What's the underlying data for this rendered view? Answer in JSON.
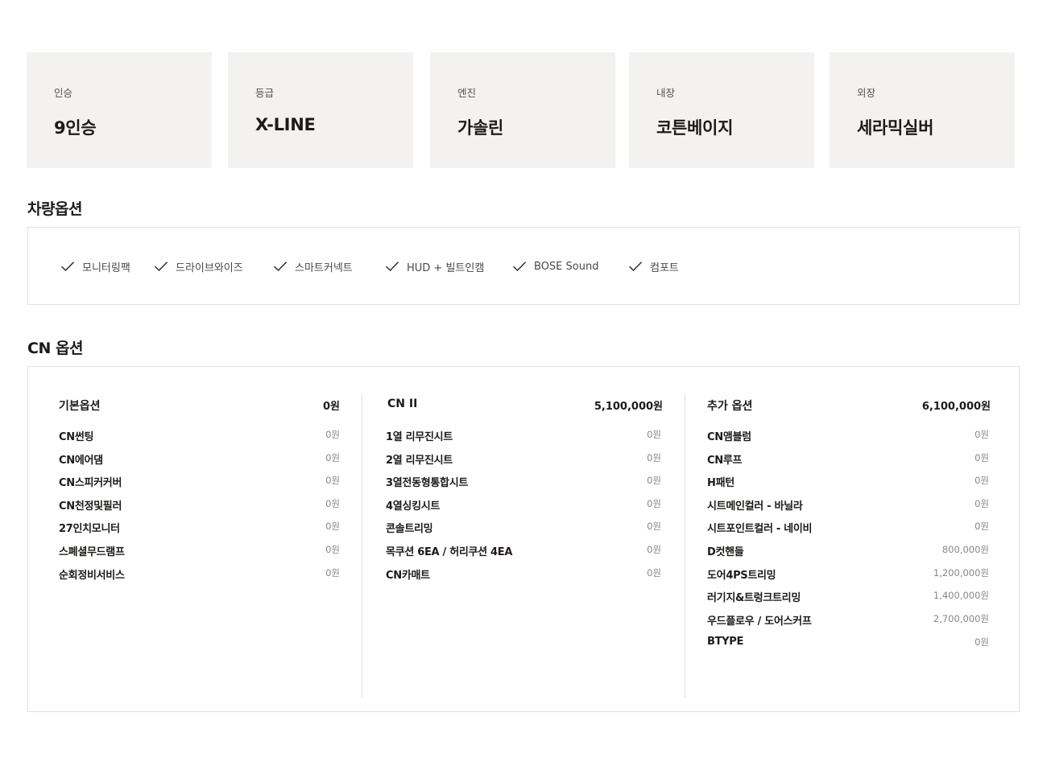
{
  "specs": [
    {
      "label": "인승",
      "value": "9인승"
    },
    {
      "label": "등급",
      "value": "X-LINE"
    },
    {
      "label": "엔진",
      "value": "가솔린"
    },
    {
      "label": "내장",
      "value": "코튼베이지"
    },
    {
      "label": "외장",
      "value": "세라믹실버"
    }
  ],
  "vehicle_options": {
    "title": "차량옵션",
    "items": [
      "모니터링팩",
      "드라이브와이즈",
      "스마트커넥트",
      "HUD + 빌트인캠",
      "BOSE Sound",
      "컴포트"
    ],
    "icon": "check-icon"
  },
  "cn_options": {
    "title": "CN 옵션",
    "columns": [
      {
        "name": "기본옵션",
        "price": "0원",
        "rows": [
          {
            "name": "CN썬팅",
            "price": "0원"
          },
          {
            "name": "CN에어댐",
            "price": "0원"
          },
          {
            "name": "CN스피커커버",
            "price": "0원"
          },
          {
            "name": "CN천정및필러",
            "price": "0원"
          },
          {
            "name": "27인치모니터",
            "price": "0원"
          },
          {
            "name": "스폐셜무드램프",
            "price": "0원"
          },
          {
            "name": "순회정비서비스",
            "price": "0원"
          }
        ]
      },
      {
        "name": "CN II",
        "price": "5,100,000원",
        "rows": [
          {
            "name": "1열 리무진시트",
            "price": "0원"
          },
          {
            "name": "2열 리무진시트",
            "price": "0원"
          },
          {
            "name": "3열전동형통합시트",
            "price": "0원"
          },
          {
            "name": "4열싱킹시트",
            "price": "0원"
          },
          {
            "name": "콘솔트리밍",
            "price": "0원"
          },
          {
            "name": "목쿠션 6EA / 허리쿠션 4EA",
            "price": "0원"
          },
          {
            "name": "CN카매트",
            "price": "0원"
          }
        ]
      },
      {
        "name": "추가 옵션",
        "price": "6,100,000원",
        "rows": [
          {
            "name": "CN앰블럼",
            "price": "0원"
          },
          {
            "name": "CN루프",
            "price": "0원"
          },
          {
            "name": "H패턴",
            "price": "0원"
          },
          {
            "name": "시트메인컬러 - 바닐라",
            "price": "0원"
          },
          {
            "name": "시트포인트컬러 - 네이비",
            "price": "0원"
          },
          {
            "name": "D컷핸들",
            "price": "800,000원"
          },
          {
            "name": "도어4PS트리밍",
            "price": "1,200,000원"
          },
          {
            "name": "러기지&트렁크트리밍",
            "price": "1,400,000원"
          },
          {
            "name": "우드플로우 / 도어스커프",
            "price": "2,700,000원"
          },
          {
            "name": "BTYPE",
            "price": "0원"
          }
        ]
      }
    ]
  },
  "colors": {
    "card_bg": "#f3f2f1",
    "border": "#e3e1df",
    "text": "#1e1a17",
    "muted": "#8a8581"
  }
}
